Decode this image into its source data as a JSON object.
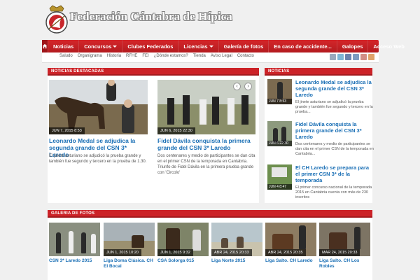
{
  "site": {
    "title": "Federación Cántabra de Hípica",
    "logo_icon": "shield-crest-icon"
  },
  "nav": {
    "home_icon": "home-icon",
    "items": [
      {
        "label": "Noticias",
        "dropdown": false
      },
      {
        "label": "Concursos",
        "dropdown": true
      },
      {
        "label": "Clubes Federados",
        "dropdown": false
      },
      {
        "label": "Licencias",
        "dropdown": true
      },
      {
        "label": "Galería de fotos",
        "dropdown": false
      },
      {
        "label": "En caso de accidente...",
        "dropdown": false
      },
      {
        "label": "Galopes",
        "dropdown": false
      },
      {
        "label": "Acceso Web",
        "dropdown": false
      }
    ]
  },
  "subnav": {
    "links": [
      "Saludo",
      "Organigrama",
      "Historia",
      "RFHE",
      "FEI",
      "¿Dónde estamos?",
      "Tienda",
      "Aviso Legal",
      "Contacto"
    ],
    "social_icons": [
      "rss-icon",
      "twitter-icon",
      "facebook-icon",
      "linkedin-icon",
      "google-icon",
      "feed-icon"
    ]
  },
  "featured": {
    "heading": "NOTICIAS DESTACADAS",
    "articles": [
      {
        "date": "JUN 7, 2015 8:53",
        "title": "Leonardo Medal se adjudica la segunda grande del CSN 3* Laredo",
        "excerpt": "El jinete asturiano se adjudicó la prueba grande y también fue segundo y tercero en la prueba de 1.30."
      },
      {
        "date": "JUN 6, 2015 22:30",
        "title": "Fidel Dávila conquista la primera grande del CSN 3* Laredo",
        "excerpt": "Dos centenares y medio de participantes se dan cita en el primer CSN de la temporada en Cantabria. Triunfo de Fidel Dávila en la primera prueba grande con 'Circolo'"
      }
    ]
  },
  "news": {
    "heading": "NOTICIAS",
    "items": [
      {
        "date": "JUN 7 8:53",
        "title": "Leonardo Medal se adjudica la segunda grande del CSN 3* Laredo",
        "excerpt": "El jinete asturiano se adjudicó la prueba grande y también fue segundo y tercero en la prueba..."
      },
      {
        "date": "JUN 6 22:30",
        "title": "Fidel Dávila conquista la primera grande del CSN 3* Laredo",
        "excerpt": "Dos centenares y medio de participantes se dan cita en el primer CSN de la temporada en Cantabria..."
      },
      {
        "date": "JUN 4 8:47",
        "title": "El CH Laredo se prepara para el primer CSN 3* de la temporada",
        "excerpt": "El primer concurso nacional de la temporada 2015 en Cantabria cuenta con más de 230 inscritos"
      }
    ]
  },
  "gallery": {
    "heading": "GALERIA DE FOTOS",
    "items": [
      {
        "date": "",
        "title": "CSN 3* Laredo 2015"
      },
      {
        "date": "JUN 1, 2015 10:20",
        "title": "Liga Doma Clásica. CH El Bocal"
      },
      {
        "date": "JUN 1, 2015 9:32",
        "title": "CSA Solorga 015"
      },
      {
        "date": "ABR 24, 2015 20:33",
        "title": "Liga Norte 2015"
      },
      {
        "date": "ABR 24, 2015 20:35",
        "title": "Liga Salto. CH Laredo"
      },
      {
        "date": "MAR 24, 2015 20:33",
        "title": "Liga Salto. CH Los Robles"
      }
    ]
  },
  "colors": {
    "accent": "#cc2227",
    "link": "#1a6fb5"
  }
}
